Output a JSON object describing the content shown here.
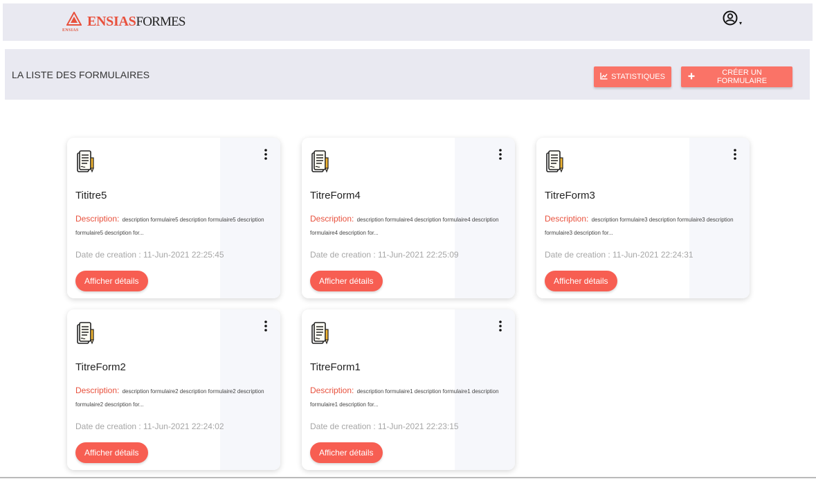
{
  "brand": {
    "mark_text": "ENSIAS",
    "name_bold": "ENSIAS",
    "name_light": "FORMES",
    "accent_color": "#e8513d"
  },
  "account": {
    "icon": "account-circle-icon",
    "caret": "▾"
  },
  "header": {
    "title": "LA LISTE DES FORMULAIRES",
    "stats_label": "STATISTIQUES",
    "stats_icon": "chart-line-icon",
    "create_label": "CRÉER UN FORMULAIRE",
    "create_icon": "plus-icon",
    "button_color": "#fa7367"
  },
  "forms": [
    {
      "title": "Tititre5",
      "description_label": "Description:",
      "description": "description formulaire5 description formulaire5 description formulaire5 description for...",
      "date": "Date de creation : 11-Jun-2021 22:25:45",
      "details_label": "Afficher détails"
    },
    {
      "title": "TitreForm4",
      "description_label": "Description:",
      "description": "description formulaire4 description formulaire4 description formulaire4 description for...",
      "date": "Date de creation : 11-Jun-2021 22:25:09",
      "details_label": "Afficher détails"
    },
    {
      "title": "TitreForm3",
      "description_label": "Description:",
      "description": "description formulaire3 description formulaire3 description formulaire3 description for...",
      "date": "Date de creation : 11-Jun-2021 22:24:31",
      "details_label": "Afficher détails"
    },
    {
      "title": "TitreForm2",
      "description_label": "Description:",
      "description": "description formulaire2 description formulaire2 description formulaire2 description for...",
      "date": "Date de creation : 11-Jun-2021 22:24:02",
      "details_label": "Afficher détails"
    },
    {
      "title": "TitreForm1",
      "description_label": "Description:",
      "description": "description formulaire1 description formulaire1 description formulaire1 description for...",
      "date": "Date de creation : 11-Jun-2021 22:23:15",
      "details_label": "Afficher détails"
    }
  ]
}
